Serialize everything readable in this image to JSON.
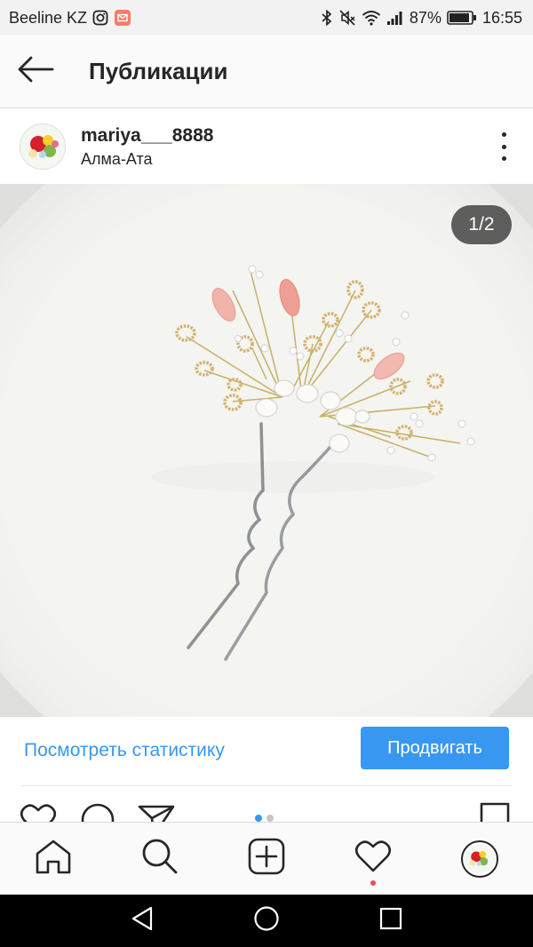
{
  "status_bar": {
    "carrier": "Beeline KZ",
    "battery_percent": "87%",
    "time": "16:55",
    "icons": [
      "instagram-icon",
      "mail-notification-icon",
      "bluetooth-icon",
      "mute-icon",
      "wifi-icon",
      "signal-icon",
      "battery-icon"
    ]
  },
  "header": {
    "title": "Публикации",
    "back_icon": "arrow-left-icon"
  },
  "post": {
    "username": "mariya___8888",
    "location": "Алма-Ата",
    "more_icon": "more-vertical-icon",
    "media": {
      "description_icon": "hairpin-photo",
      "counter": "1/2",
      "slide_total": 2,
      "slide_active": 1
    },
    "stats_link": "Посмотреть статистику",
    "promote_button": "Продвигать",
    "actions": [
      "heart-icon",
      "comment-icon",
      "share-icon",
      "bookmark-icon"
    ]
  },
  "bottom_nav": {
    "items": [
      "home-icon",
      "search-icon",
      "add-post-icon",
      "activity-heart-icon",
      "profile-avatar"
    ],
    "notification_dot": true
  },
  "system_nav": [
    "back-triangle-icon",
    "home-circle-icon",
    "recents-square-icon"
  ],
  "colors": {
    "accent": "#3897f0",
    "text": "#262626",
    "notification": "#ed4956",
    "header_bg": "#fafafa",
    "status_bar_bg": "#f2f2f2"
  }
}
